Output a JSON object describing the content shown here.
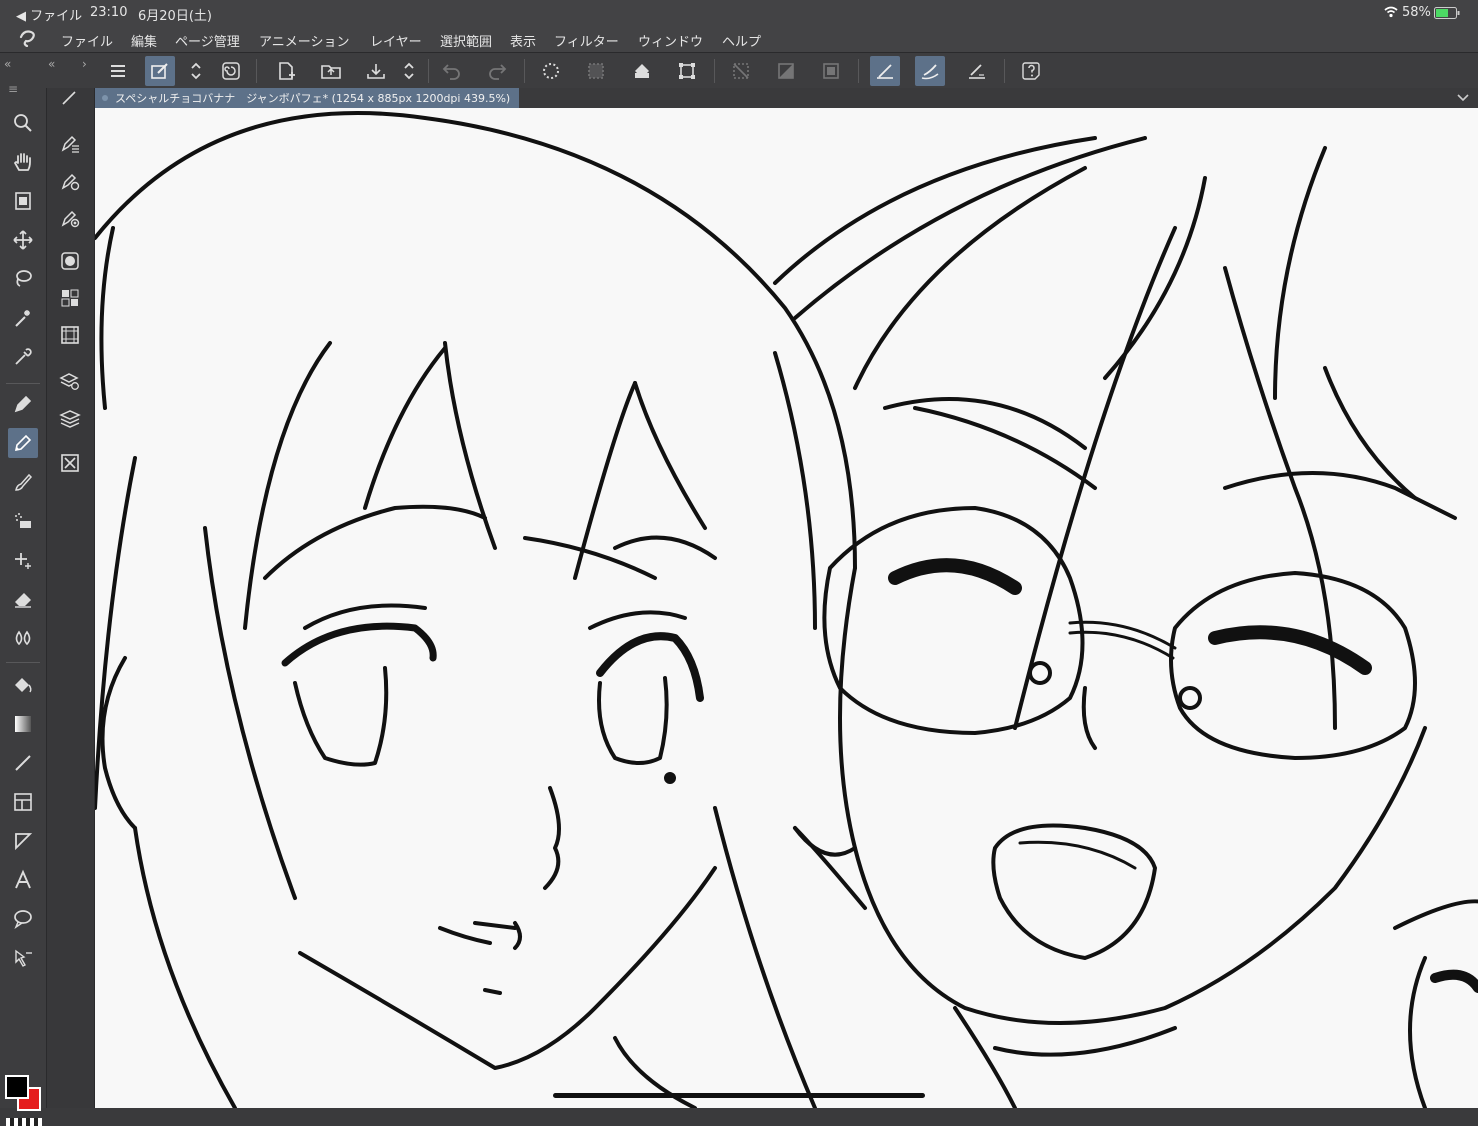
{
  "status": {
    "back": "◀ ファイル",
    "time": "23:10",
    "date": "6月20日(土)",
    "battery": "58%"
  },
  "menu": [
    "ファイル",
    "編集",
    "ページ管理",
    "アニメーション",
    "レイヤー",
    "選択範囲",
    "表示",
    "フィルター",
    "ウィンドウ",
    "ヘルプ"
  ],
  "document": {
    "tab_title": "スペシャルチョコバナナ　ジャンボパフェ* (1254 x 885px 1200dpi 439.5%)"
  },
  "colors": {
    "main": "#000000",
    "sub": "#e51c1c",
    "accent": "#5d7189"
  }
}
